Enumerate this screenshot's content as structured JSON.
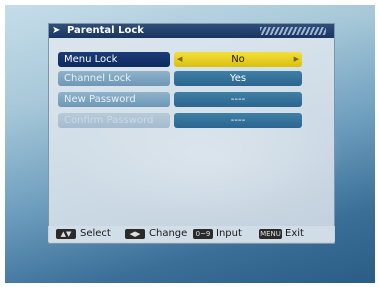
{
  "title": "Parental Lock",
  "menu": [
    {
      "label": "Menu Lock",
      "value": "No",
      "state": "active"
    },
    {
      "label": "Channel Lock",
      "value": "Yes",
      "state": "normal"
    },
    {
      "label": "New Password",
      "value": "----",
      "state": "normal"
    },
    {
      "label": "Confirm Password",
      "value": "----",
      "state": "disabled"
    }
  ],
  "help": {
    "select": "Select",
    "change": "Change",
    "input": "Input",
    "exit": "Exit",
    "key_input": "0~9",
    "key_exit": "MENU"
  },
  "colors": {
    "active_value_bg": "#e6cc1f",
    "active_label_bg": "#15336b",
    "value_bg": "#3575a0",
    "title_bg": "#23416d"
  },
  "icons": {
    "title": "arrow-right-icon",
    "active_left": "triangle-left-icon",
    "active_right": "triangle-right-icon",
    "select_key": "up-down-keys-icon",
    "change_key": "left-right-keys-icon"
  }
}
